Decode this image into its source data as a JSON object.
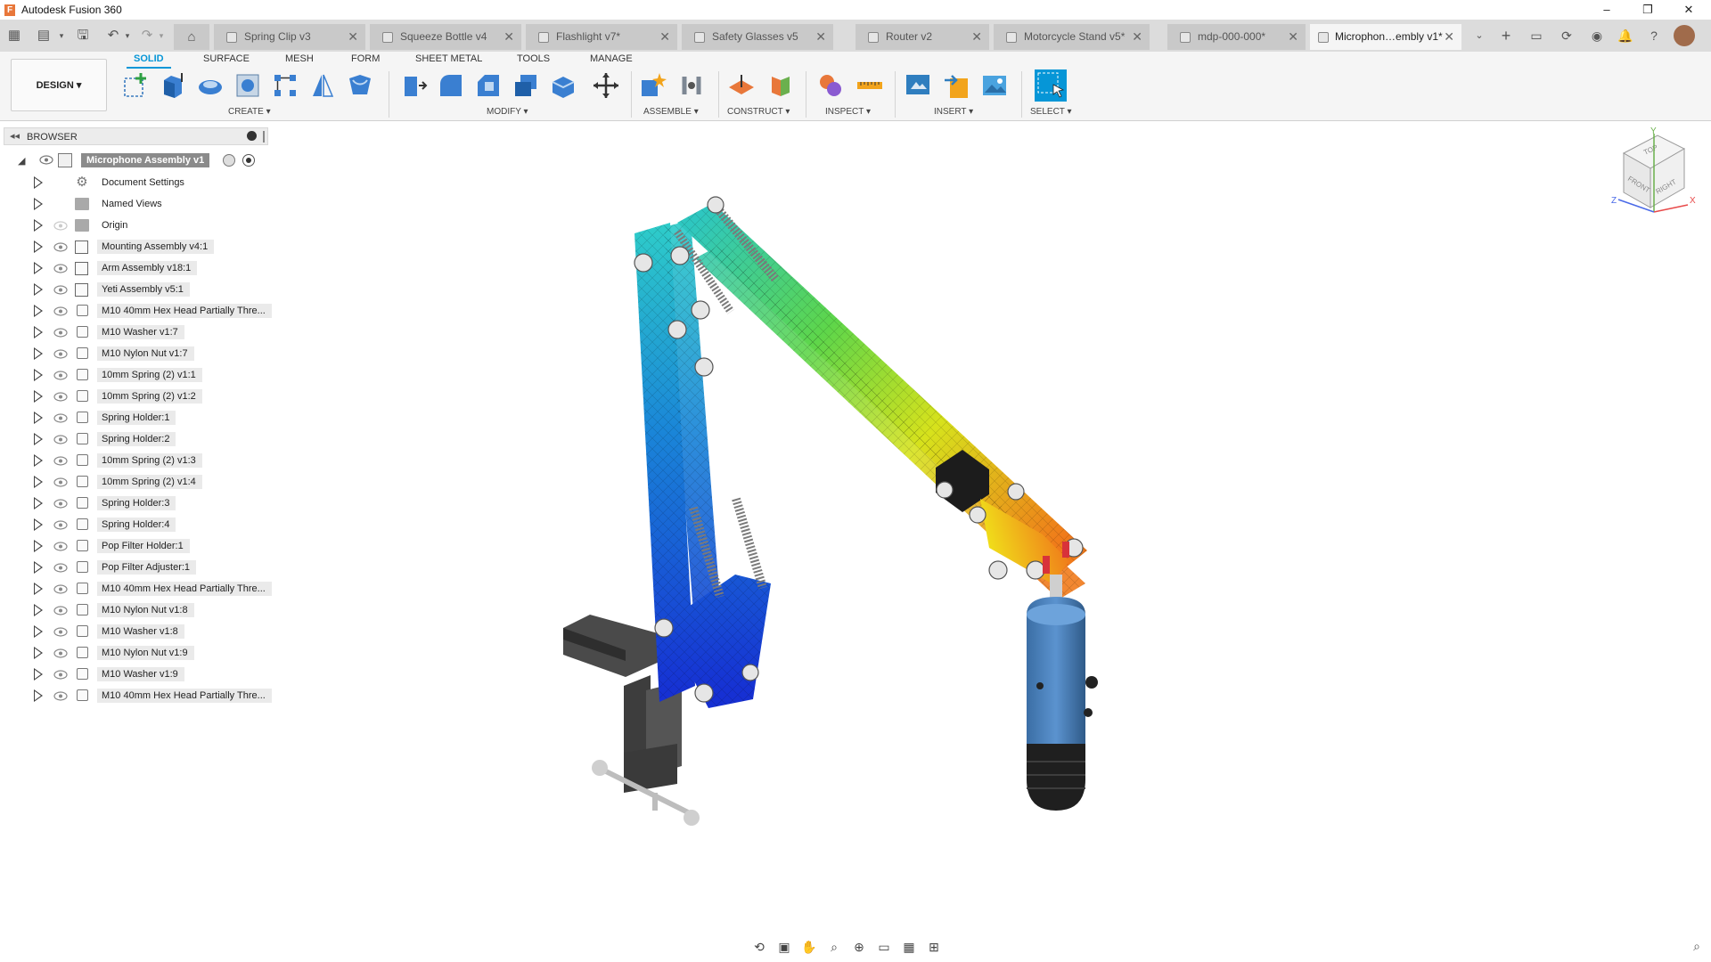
{
  "app": {
    "title": "Autodesk Fusion 360",
    "logo_letter": "F"
  },
  "window_controls": {
    "minimize": "–",
    "restore": "❐",
    "close": "✕"
  },
  "doc_tabs": [
    {
      "label": "Spring Clip v3"
    },
    {
      "label": "Squeeze Bottle v4"
    },
    {
      "label": "Flashlight v7*"
    },
    {
      "label": "Safety Glasses v5"
    },
    {
      "label": "Router v2"
    },
    {
      "label": "Motorcycle Stand v5*"
    },
    {
      "label": "mdp-000-000*"
    },
    {
      "label": "Microphon…embly v1*"
    }
  ],
  "tab_close_glyph": "✕",
  "workspace": {
    "label": "DESIGN ▾"
  },
  "ribbon_tabs": [
    "SOLID",
    "SURFACE",
    "MESH",
    "FORM",
    "SHEET METAL",
    "TOOLS",
    "MANAGE"
  ],
  "ribbon_groups": [
    "CREATE ▾",
    "MODIFY ▾",
    "ASSEMBLE ▾",
    "CONSTRUCT ▾",
    "INSPECT ▾",
    "INSERT ▾",
    "SELECT ▾"
  ],
  "browser": {
    "title": "BROWSER",
    "collapse_glyph": "◂◂",
    "root": "Microphone Assembly v1",
    "items": [
      {
        "label": "Document Settings",
        "icon": "gear-icon"
      },
      {
        "label": "Named Views",
        "icon": "folder-icon"
      },
      {
        "label": "Origin",
        "icon": "folder-icon"
      },
      {
        "label": "Mounting Assembly v4:1",
        "icon": "component-icon"
      },
      {
        "label": "Arm Assembly v18:1",
        "icon": "component-icon"
      },
      {
        "label": "Yeti Assembly v5:1",
        "icon": "component-icon"
      },
      {
        "label": "M10 40mm Hex Head Partially Thre...",
        "icon": "body-icon"
      },
      {
        "label": "M10 Washer v1:7",
        "icon": "body-icon"
      },
      {
        "label": "M10 Nylon Nut v1:7",
        "icon": "body-icon"
      },
      {
        "label": "10mm Spring (2) v1:1",
        "icon": "body-icon"
      },
      {
        "label": "10mm Spring (2) v1:2",
        "icon": "body-icon"
      },
      {
        "label": "Spring Holder:1",
        "icon": "body-icon"
      },
      {
        "label": "Spring Holder:2",
        "icon": "body-icon"
      },
      {
        "label": "10mm Spring (2) v1:3",
        "icon": "body-icon"
      },
      {
        "label": "10mm Spring (2) v1:4",
        "icon": "body-icon"
      },
      {
        "label": "Spring Holder:3",
        "icon": "body-icon"
      },
      {
        "label": "Spring Holder:4",
        "icon": "body-icon"
      },
      {
        "label": "Pop Filter Holder:1",
        "icon": "body-icon"
      },
      {
        "label": "Pop Filter Adjuster:1",
        "icon": "body-icon"
      },
      {
        "label": "M10 40mm Hex Head Partially Thre...",
        "icon": "body-icon"
      },
      {
        "label": "M10 Nylon Nut v1:8",
        "icon": "body-icon"
      },
      {
        "label": "M10 Washer v1:8",
        "icon": "body-icon"
      },
      {
        "label": "M10 Nylon Nut v1:9",
        "icon": "body-icon"
      },
      {
        "label": "M10 Washer v1:9",
        "icon": "body-icon"
      },
      {
        "label": "M10 40mm Hex Head Partially Thre...",
        "icon": "body-icon"
      }
    ]
  },
  "viewcube": {
    "top": "TOP",
    "front": "FRONT",
    "right": "RIGHT",
    "x": "X",
    "y": "Y",
    "z": "Z"
  },
  "colors": {
    "accent": "#0696d7",
    "tab_bg": "#dcdcdc",
    "ribbon_bg": "#f5f5f5",
    "root_highlight": "#8b8b8b"
  }
}
